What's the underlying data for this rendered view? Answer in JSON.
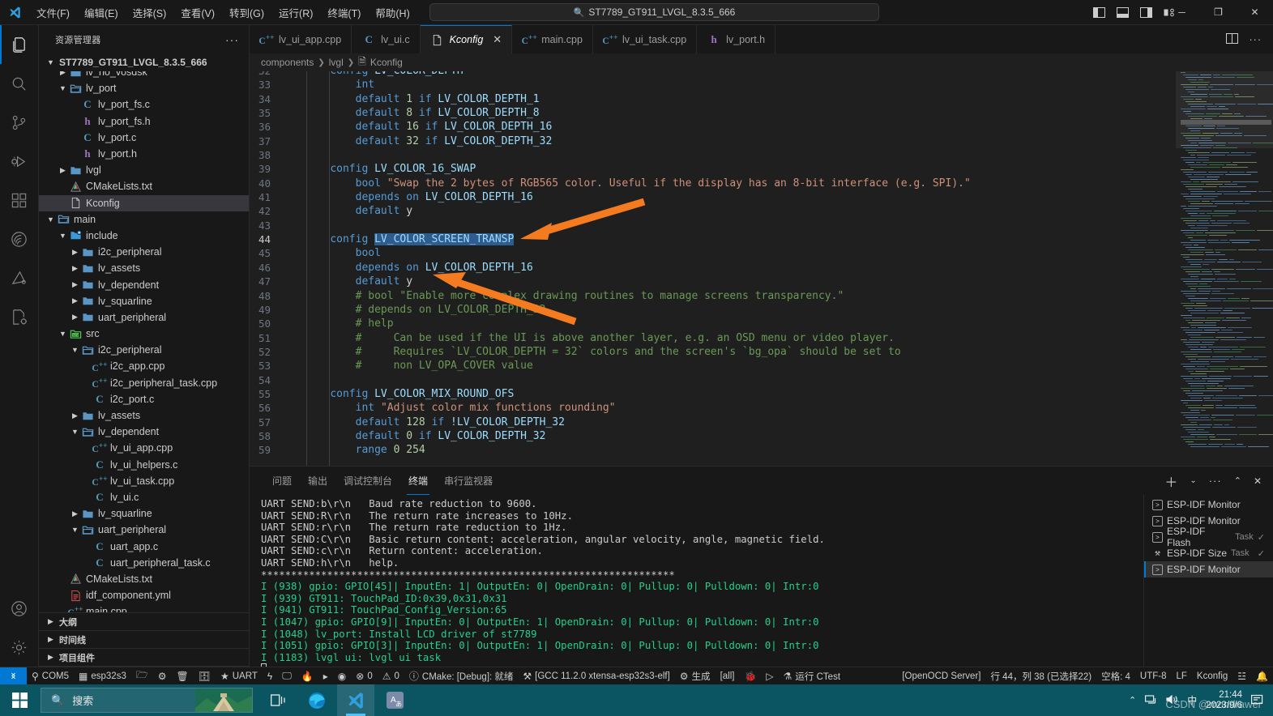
{
  "titlebar": {
    "menus": [
      "文件(F)",
      "编辑(E)",
      "选择(S)",
      "查看(V)",
      "转到(G)",
      "运行(R)",
      "终端(T)",
      "帮助(H)"
    ],
    "back_icon": "arrow-left-icon",
    "forward_icon": "arrow-right-icon",
    "quick_open_value": "ST7789_GT911_LVGL_8.3.5_666",
    "layout_icons": [
      "toggle-primary-sidebar-icon",
      "toggle-panel-icon",
      "toggle-secondary-sidebar-icon",
      "customize-layout-icon"
    ],
    "window_minimize": "─",
    "window_restore": "❐",
    "window_close": "✕"
  },
  "activitybar": {
    "items": [
      {
        "name": "explorer-icon",
        "active": true
      },
      {
        "name": "search-icon",
        "active": false
      },
      {
        "name": "source-control-icon",
        "active": false
      },
      {
        "name": "run-and-debug-icon",
        "active": false
      },
      {
        "name": "extensions-icon",
        "active": false
      },
      {
        "name": "espressif-idf-icon",
        "active": false
      },
      {
        "name": "squareline-icon",
        "active": false
      },
      {
        "name": "cmake-icon",
        "active": false
      }
    ],
    "bottom": [
      {
        "name": "accounts-icon"
      },
      {
        "name": "settings-gear-icon"
      }
    ]
  },
  "sidebar": {
    "title": "资源管理器",
    "more_actions": "···",
    "root": "ST7789_GT911_LVGL_8.3.5_666",
    "tree": [
      {
        "label": "lv_no_vosdsk",
        "depth": 2,
        "chev": "right",
        "icon": "folder",
        "clipped": true
      },
      {
        "label": "lv_port",
        "depth": 2,
        "chev": "down",
        "icon": "folder-open"
      },
      {
        "label": "lv_port_fs.c",
        "depth": 3,
        "chev": "none",
        "icon": "c"
      },
      {
        "label": "lv_port_fs.h",
        "depth": 3,
        "chev": "none",
        "icon": "h"
      },
      {
        "label": "lv_port.c",
        "depth": 3,
        "chev": "none",
        "icon": "c"
      },
      {
        "label": "lv_port.h",
        "depth": 3,
        "chev": "none",
        "icon": "h"
      },
      {
        "label": "lvgl",
        "depth": 2,
        "chev": "right",
        "icon": "folder"
      },
      {
        "label": "CMakeLists.txt",
        "depth": 2,
        "chev": "none",
        "icon": "cmake"
      },
      {
        "label": "Kconfig",
        "depth": 2,
        "chev": "none",
        "icon": "file",
        "selected": true
      },
      {
        "label": "main",
        "depth": 1,
        "chev": "down",
        "icon": "folder-open"
      },
      {
        "label": "include",
        "depth": 2,
        "chev": "down",
        "icon": "folder-include"
      },
      {
        "label": "i2c_peripheral",
        "depth": 3,
        "chev": "right",
        "icon": "folder"
      },
      {
        "label": "lv_assets",
        "depth": 3,
        "chev": "right",
        "icon": "folder"
      },
      {
        "label": "lv_dependent",
        "depth": 3,
        "chev": "right",
        "icon": "folder"
      },
      {
        "label": "lv_squarline",
        "depth": 3,
        "chev": "right",
        "icon": "folder"
      },
      {
        "label": "uart_peripheral",
        "depth": 3,
        "chev": "right",
        "icon": "folder"
      },
      {
        "label": "src",
        "depth": 2,
        "chev": "down",
        "icon": "folder-src"
      },
      {
        "label": "i2c_peripheral",
        "depth": 3,
        "chev": "down",
        "icon": "folder-open"
      },
      {
        "label": "i2c_app.cpp",
        "depth": 4,
        "chev": "none",
        "icon": "cpp"
      },
      {
        "label": "i2c_peripheral_task.cpp",
        "depth": 4,
        "chev": "none",
        "icon": "cpp"
      },
      {
        "label": "i2c_port.c",
        "depth": 4,
        "chev": "none",
        "icon": "c"
      },
      {
        "label": "lv_assets",
        "depth": 3,
        "chev": "right",
        "icon": "folder"
      },
      {
        "label": "lv_dependent",
        "depth": 3,
        "chev": "down",
        "icon": "folder-open"
      },
      {
        "label": "lv_ui_app.cpp",
        "depth": 4,
        "chev": "none",
        "icon": "cpp"
      },
      {
        "label": "lv_ui_helpers.c",
        "depth": 4,
        "chev": "none",
        "icon": "c"
      },
      {
        "label": "lv_ui_task.cpp",
        "depth": 4,
        "chev": "none",
        "icon": "cpp"
      },
      {
        "label": "lv_ui.c",
        "depth": 4,
        "chev": "none",
        "icon": "c"
      },
      {
        "label": "lv_squarline",
        "depth": 3,
        "chev": "right",
        "icon": "folder"
      },
      {
        "label": "uart_peripheral",
        "depth": 3,
        "chev": "down",
        "icon": "folder-open"
      },
      {
        "label": "uart_app.c",
        "depth": 4,
        "chev": "none",
        "icon": "c"
      },
      {
        "label": "uart_peripheral_task.c",
        "depth": 4,
        "chev": "none",
        "icon": "c"
      },
      {
        "label": "CMakeLists.txt",
        "depth": 2,
        "chev": "none",
        "icon": "cmake"
      },
      {
        "label": "idf_component.yml",
        "depth": 2,
        "chev": "none",
        "icon": "yml"
      },
      {
        "label": "main.cpp",
        "depth": 2,
        "chev": "none",
        "icon": "cpp"
      }
    ],
    "sections": [
      "大纲",
      "时间线",
      "项目组件"
    ]
  },
  "tabs": [
    {
      "label": "lv_ui_app.cpp",
      "icon": "cpp",
      "active": false
    },
    {
      "label": "lv_ui.c",
      "icon": "c",
      "active": false
    },
    {
      "label": "Kconfig",
      "icon": "file",
      "active": true,
      "close": "✕"
    },
    {
      "label": "main.cpp",
      "icon": "cpp",
      "active": false
    },
    {
      "label": "lv_ui_task.cpp",
      "icon": "cpp",
      "active": false
    },
    {
      "label": "lv_port.h",
      "icon": "h",
      "active": false
    }
  ],
  "tab_actions": [
    "split-editor-icon",
    "more-actions-icon"
  ],
  "breadcrumb": [
    "components",
    "lvgl",
    "Kconfig"
  ],
  "editor": {
    "first_line": 32,
    "lines": [
      {
        "n": 32,
        "tokens": [
          {
            "t": "config ",
            "c": "kw"
          },
          {
            "t": "LV_COLOR_DEPTH",
            "c": "id"
          }
        ],
        "indent": 1,
        "clipped": true
      },
      {
        "n": 33,
        "tokens": [
          {
            "t": "int",
            "c": "kw"
          }
        ],
        "indent": 2
      },
      {
        "n": 34,
        "tokens": [
          {
            "t": "default ",
            "c": "kw"
          },
          {
            "t": "1",
            "c": "num"
          },
          {
            "t": " if ",
            "c": "kw"
          },
          {
            "t": "LV_COLOR_DEPTH_1",
            "c": "id"
          }
        ],
        "indent": 2
      },
      {
        "n": 35,
        "tokens": [
          {
            "t": "default ",
            "c": "kw"
          },
          {
            "t": "8",
            "c": "num"
          },
          {
            "t": " if ",
            "c": "kw"
          },
          {
            "t": "LV_COLOR_DEPTH_8",
            "c": "id"
          }
        ],
        "indent": 2
      },
      {
        "n": 36,
        "tokens": [
          {
            "t": "default ",
            "c": "kw"
          },
          {
            "t": "16",
            "c": "num"
          },
          {
            "t": " if ",
            "c": "kw"
          },
          {
            "t": "LV_COLOR_DEPTH_16",
            "c": "id"
          }
        ],
        "indent": 2
      },
      {
        "n": 37,
        "tokens": [
          {
            "t": "default ",
            "c": "kw"
          },
          {
            "t": "32",
            "c": "num"
          },
          {
            "t": " if ",
            "c": "kw"
          },
          {
            "t": "LV_COLOR_DEPTH_32",
            "c": "id"
          }
        ],
        "indent": 2
      },
      {
        "n": 38,
        "tokens": [],
        "indent": 0
      },
      {
        "n": 39,
        "tokens": [
          {
            "t": "config ",
            "c": "kw"
          },
          {
            "t": "LV_COLOR_16_SWAP",
            "c": "id"
          }
        ],
        "indent": 1
      },
      {
        "n": 40,
        "tokens": [
          {
            "t": "bool ",
            "c": "kw"
          },
          {
            "t": "\"Swap the 2 bytes of RGB565 color. Useful if the display has an 8-bit interface (e.g. SPI).\"",
            "c": "str"
          }
        ],
        "indent": 2
      },
      {
        "n": 41,
        "tokens": [
          {
            "t": "depends on ",
            "c": "kw"
          },
          {
            "t": "LV_COLOR_DEPTH_16",
            "c": "id"
          }
        ],
        "indent": 2
      },
      {
        "n": 42,
        "tokens": [
          {
            "t": "default ",
            "c": "kw"
          },
          {
            "t": "y",
            "c": "plain"
          }
        ],
        "indent": 2
      },
      {
        "n": 43,
        "tokens": [],
        "indent": 0
      },
      {
        "n": 44,
        "tokens": [
          {
            "t": "config ",
            "c": "kw"
          },
          {
            "t": "LV_COLOR_SCREEN_TRANSP",
            "c": "id",
            "sel": true
          }
        ],
        "indent": 1,
        "current": true
      },
      {
        "n": 45,
        "tokens": [
          {
            "t": "bool",
            "c": "kw"
          }
        ],
        "indent": 2
      },
      {
        "n": 46,
        "tokens": [
          {
            "t": "depends on ",
            "c": "kw"
          },
          {
            "t": "LV_COLOR_DEPTH_16",
            "c": "id"
          }
        ],
        "indent": 2
      },
      {
        "n": 47,
        "tokens": [
          {
            "t": "default ",
            "c": "kw"
          },
          {
            "t": "y",
            "c": "plain"
          }
        ],
        "indent": 2
      },
      {
        "n": 48,
        "tokens": [
          {
            "t": "# bool \"Enable more complex drawing routines to manage screens transparency.\"",
            "c": "cm"
          }
        ],
        "indent": 2
      },
      {
        "n": 49,
        "tokens": [
          {
            "t": "# depends on LV_COLOR_DEPTH_32",
            "c": "cm"
          }
        ],
        "indent": 2
      },
      {
        "n": 50,
        "tokens": [
          {
            "t": "# help",
            "c": "cm"
          }
        ],
        "indent": 2
      },
      {
        "n": 51,
        "tokens": [
          {
            "t": "#     Can be used if the UI is above another layer, e.g. an OSD menu or video player.",
            "c": "cm"
          }
        ],
        "indent": 2
      },
      {
        "n": 52,
        "tokens": [
          {
            "t": "#     Requires `LV_COLOR_DEPTH = 32` colors and the screen's `bg_opa` should be set to",
            "c": "cm"
          }
        ],
        "indent": 2
      },
      {
        "n": 53,
        "tokens": [
          {
            "t": "#     non LV_OPA_COVER value",
            "c": "cm"
          }
        ],
        "indent": 2
      },
      {
        "n": 54,
        "tokens": [],
        "indent": 0
      },
      {
        "n": 55,
        "tokens": [
          {
            "t": "config ",
            "c": "kw"
          },
          {
            "t": "LV_COLOR_MIX_ROUND_OFS",
            "c": "id"
          }
        ],
        "indent": 1
      },
      {
        "n": 56,
        "tokens": [
          {
            "t": "int ",
            "c": "kw"
          },
          {
            "t": "\"Adjust color mix functions rounding\"",
            "c": "str"
          }
        ],
        "indent": 2
      },
      {
        "n": 57,
        "tokens": [
          {
            "t": "default ",
            "c": "kw"
          },
          {
            "t": "128",
            "c": "num"
          },
          {
            "t": " if ",
            "c": "kw"
          },
          {
            "t": "!LV_COLOR_DEPTH_32",
            "c": "id"
          }
        ],
        "indent": 2
      },
      {
        "n": 58,
        "tokens": [
          {
            "t": "default ",
            "c": "kw"
          },
          {
            "t": "0",
            "c": "num"
          },
          {
            "t": " if ",
            "c": "kw"
          },
          {
            "t": "LV_COLOR_DEPTH_32",
            "c": "id"
          }
        ],
        "indent": 2
      },
      {
        "n": 59,
        "tokens": [
          {
            "t": "range ",
            "c": "kw"
          },
          {
            "t": "0 254",
            "c": "num"
          }
        ],
        "indent": 2
      }
    ]
  },
  "panel": {
    "tabs": [
      {
        "label": "问题",
        "active": false
      },
      {
        "label": "输出",
        "active": false
      },
      {
        "label": "调试控制台",
        "active": false
      },
      {
        "label": "终端",
        "active": true
      },
      {
        "label": "串行监视器",
        "active": false
      }
    ],
    "actions": [
      "add-terminal-icon",
      "split-dropdown-icon",
      "more-actions-icon",
      "maximize-panel-icon",
      "close-panel-icon"
    ],
    "terminal_lines": [
      {
        "text": "UART SEND:b\\r\\n   Baud rate reduction to 9600.",
        "color": "w"
      },
      {
        "text": "UART SEND:R\\r\\n   The return rate increases to 10Hz.",
        "color": "w"
      },
      {
        "text": "UART SEND:r\\r\\n   The return rate reduction to 1Hz.",
        "color": "w"
      },
      {
        "text": "UART SEND:C\\r\\n   Basic return content: acceleration, angular velocity, angle, magnetic field.",
        "color": "w"
      },
      {
        "text": "UART SEND:c\\r\\n   Return content: acceleration.",
        "color": "w"
      },
      {
        "text": "UART SEND:h\\r\\n   help.",
        "color": "w"
      },
      {
        "text": "*********************************************************************",
        "color": "w"
      },
      {
        "text": "I (938) gpio: GPIO[45]| InputEn: 1| OutputEn: 0| OpenDrain: 0| Pullup: 0| Pulldown: 0| Intr:0",
        "color": "g"
      },
      {
        "text": "I (939) GT911: TouchPad_ID:0x39,0x31,0x31",
        "color": "g"
      },
      {
        "text": "I (941) GT911: TouchPad_Config_Version:65",
        "color": "g"
      },
      {
        "text": "I (1047) gpio: GPIO[9]| InputEn: 0| OutputEn: 1| OpenDrain: 0| Pullup: 0| Pulldown: 0| Intr:0",
        "color": "g"
      },
      {
        "text": "I (1048) lv_port: Install LCD driver of st7789",
        "color": "g"
      },
      {
        "text": "I (1051) gpio: GPIO[3]| InputEn: 0| OutputEn: 1| OpenDrain: 0| Pullup: 0| Pulldown: 0| Intr:0",
        "color": "g"
      },
      {
        "text": "I (1183) lvgl ui: lvgl ui task",
        "color": "g"
      }
    ],
    "terminal_list": [
      {
        "label": "ESP-IDF Monitor",
        "icon": "terminal-icon",
        "tag": "",
        "check": "",
        "selected": false
      },
      {
        "label": "ESP-IDF Monitor",
        "icon": "terminal-icon",
        "tag": "",
        "check": "",
        "selected": false
      },
      {
        "label": "ESP-IDF Flash",
        "icon": "terminal-icon",
        "tag": "Task",
        "check": "✓",
        "selected": false
      },
      {
        "label": "ESP-IDF Size",
        "icon": "tools-icon",
        "tag": "Task",
        "check": "✓",
        "selected": false
      },
      {
        "label": "ESP-IDF Monitor",
        "icon": "terminal-icon",
        "tag": "",
        "check": "",
        "selected": true
      }
    ]
  },
  "statusbar": {
    "remote_icon": "remote-window-icon",
    "left": [
      {
        "icon": "plug-icon",
        "label": "COM5"
      },
      {
        "icon": "chip-icon",
        "label": "esp32s3"
      },
      {
        "icon": "folder-open-icon",
        "label": ""
      },
      {
        "icon": "gear-icon",
        "label": ""
      },
      {
        "icon": "trash-icon",
        "label": ""
      },
      {
        "icon": "database-icon",
        "label": ""
      },
      {
        "icon": "star-icon",
        "label": "UART"
      },
      {
        "icon": "lightning-icon",
        "label": ""
      },
      {
        "icon": "monitor-icon",
        "label": ""
      },
      {
        "icon": "flame-icon",
        "label": ""
      },
      {
        "icon": "terminal-icon",
        "label": ""
      },
      {
        "icon": "target-icon",
        "label": ""
      },
      {
        "icon": "error-icon",
        "label": "0"
      },
      {
        "icon": "warning-icon",
        "label": "0"
      },
      {
        "icon": "info-icon",
        "label": "CMake: [Debug]: 就绪"
      },
      {
        "icon": "tools-icon",
        "label": "[GCC 11.2.0 xtensa-esp32s3-elf]"
      },
      {
        "icon": "gear-icon",
        "label": "生成"
      },
      {
        "icon": "",
        "label": "[all]"
      },
      {
        "icon": "bug-icon",
        "label": ""
      },
      {
        "icon": "play-icon",
        "label": ""
      },
      {
        "icon": "beaker-icon",
        "label": "运行 CTest"
      }
    ],
    "right": [
      {
        "icon": "",
        "label": "[OpenOCD Server]"
      },
      {
        "icon": "",
        "label": "行 44，列 38 (已选择22)"
      },
      {
        "icon": "",
        "label": "空格: 4"
      },
      {
        "icon": "",
        "label": "UTF-8"
      },
      {
        "icon": "",
        "label": "LF"
      },
      {
        "icon": "",
        "label": "Kconfig"
      },
      {
        "icon": "feedback-icon",
        "label": ""
      },
      {
        "icon": "bell-icon",
        "label": ""
      }
    ]
  },
  "taskbar": {
    "start_icon": "windows-start-icon",
    "search_placeholder": "搜索",
    "search_icon": "search-icon",
    "apps": [
      {
        "name": "task-view-icon",
        "active": false
      },
      {
        "name": "edge-browser-icon",
        "active": false
      },
      {
        "name": "vscode-icon",
        "active": true
      },
      {
        "name": "ime-icon",
        "active": false
      }
    ],
    "tray": {
      "chevron": "⌃",
      "network_icon": "network-icon",
      "volume_icon": "volume-icon",
      "ime_label": "中",
      "time": "21:44",
      "date": "2023/9/6",
      "notification_icon": "notification-icon"
    },
    "watermark": "CSDN @mondrawer"
  },
  "annotations": {
    "arrow1": "points to LV_COLOR_SCREEN_TRANSP on line 44",
    "arrow2": "points to default y on line 47",
    "color": "#f47b20"
  }
}
